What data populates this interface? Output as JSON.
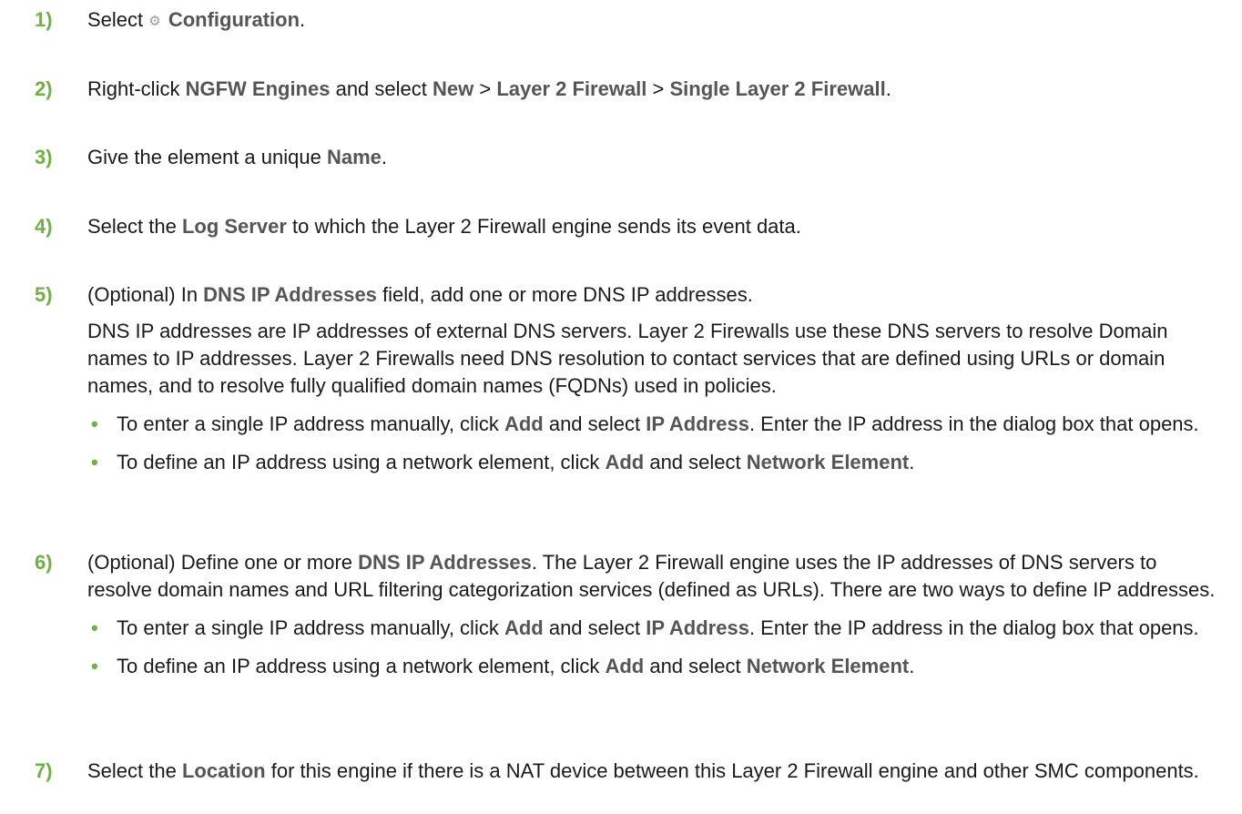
{
  "steps": [
    {
      "num": "1)",
      "parts": [
        "Select ",
        "Configuration",
        "."
      ]
    },
    {
      "num": "2)",
      "parts": [
        "Right-click ",
        "NGFW Engines",
        " and select ",
        "New",
        " > ",
        "Layer 2 Firewall",
        " > ",
        "Single Layer 2 Firewall",
        "."
      ]
    },
    {
      "num": "3)",
      "parts": [
        "Give the element a unique ",
        "Name",
        "."
      ]
    },
    {
      "num": "4)",
      "parts": [
        "Select the ",
        "Log Server",
        " to which the Layer 2 Firewall engine sends its event data."
      ]
    },
    {
      "num": "5)",
      "parts": [
        "(Optional) In ",
        "DNS IP Addresses",
        " field, add one or more DNS IP addresses."
      ],
      "para": "DNS IP addresses are IP addresses of external DNS servers. Layer 2 Firewalls use these DNS servers to resolve Domain names to IP addresses. Layer 2 Firewalls need DNS resolution to contact services that are defined using URLs or domain names, and to resolve fully qualified domain names (FQDNs) used in policies.",
      "bullets": [
        {
          "parts": [
            "To enter a single IP address manually, click ",
            "Add",
            " and select ",
            "IP Address",
            ". Enter the IP address in the dialog box that opens."
          ]
        },
        {
          "parts": [
            "To define an IP address using a network element, click ",
            "Add",
            " and select ",
            "Network Element",
            "."
          ]
        }
      ]
    },
    {
      "num": "6)",
      "parts": [
        "(Optional) Define one or more ",
        "DNS IP Addresses",
        ". The Layer 2 Firewall engine uses the IP addresses of DNS servers to resolve domain names and URL filtering categorization services (defined as URLs). There are two ways to define IP addresses."
      ],
      "bullets": [
        {
          "parts": [
            "To enter a single IP address manually, click ",
            "Add",
            " and select ",
            "IP Address",
            ". Enter the IP address in the dialog box that opens."
          ]
        },
        {
          "parts": [
            "To define an IP address using a network element, click ",
            "Add",
            " and select ",
            "Network Element",
            "."
          ]
        }
      ]
    },
    {
      "num": "7)",
      "parts": [
        "Select the ",
        "Location",
        " for this engine if there is a NAT device between this Layer 2 Firewall engine and other SMC components."
      ]
    }
  ],
  "bullet_char": "•",
  "colors": {
    "number": "#6cb33f",
    "ui_label": "#555555",
    "text": "#1a1a1a"
  },
  "icons": {
    "configuration": "gear-icon"
  }
}
